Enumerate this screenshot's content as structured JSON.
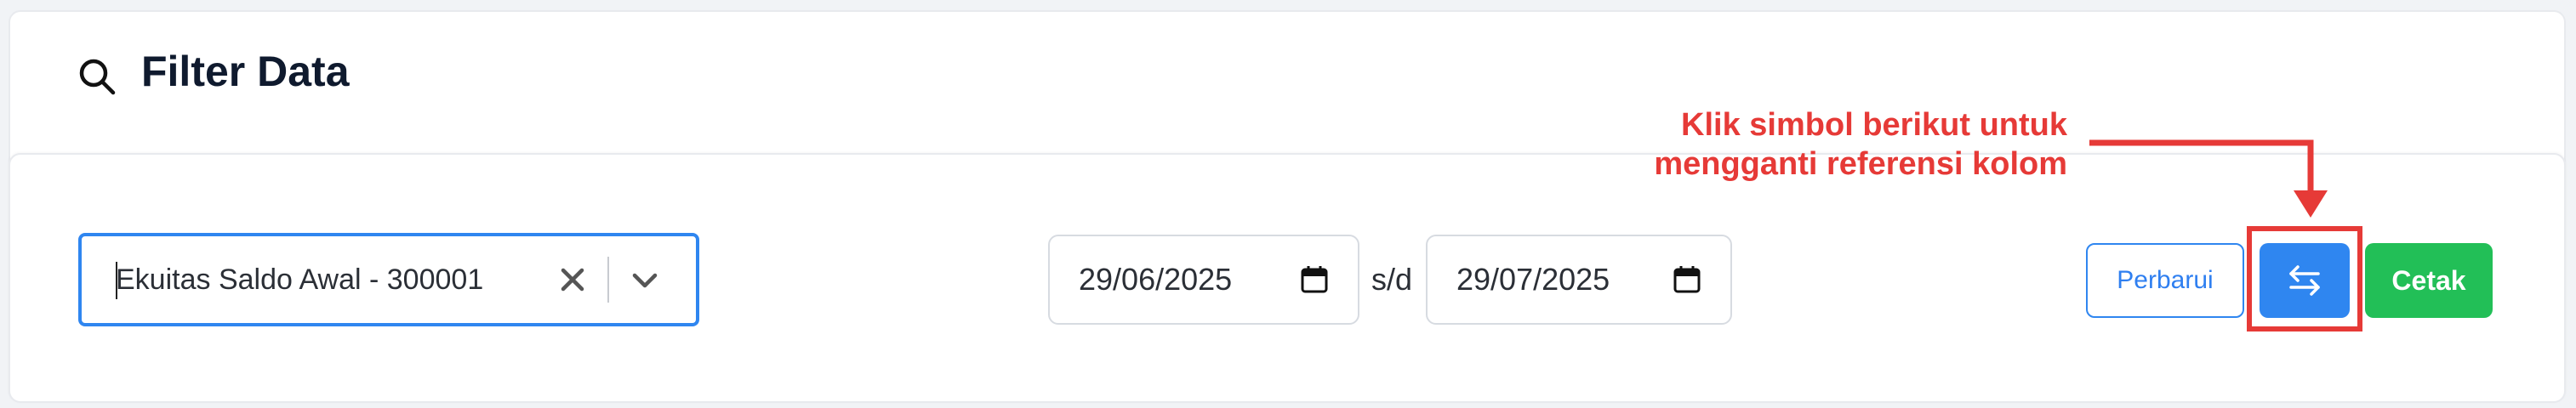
{
  "header": {
    "title": "Filter Data",
    "icon": "search-icon"
  },
  "filters": {
    "account_select": {
      "value": "Ekuitas Saldo Awal - 300001",
      "clear_icon": "close-icon",
      "dropdown_icon": "chevron-down-icon"
    },
    "date_from": {
      "value": "29/06/2025",
      "icon": "calendar-icon"
    },
    "range_separator": "s/d",
    "date_to": {
      "value": "29/07/2025",
      "icon": "calendar-icon"
    }
  },
  "actions": {
    "refresh_label": "Perbarui",
    "swap_icon": "swap-arrows-icon",
    "print_label": "Cetak"
  },
  "annotation": {
    "line1": "Klik simbol berikut untuk",
    "line2": "mengganti referensi kolom"
  },
  "colors": {
    "primary": "#2f86f0",
    "success": "#22bf57",
    "annotation_red": "#e63a37",
    "title_text": "#0f1a2e"
  }
}
